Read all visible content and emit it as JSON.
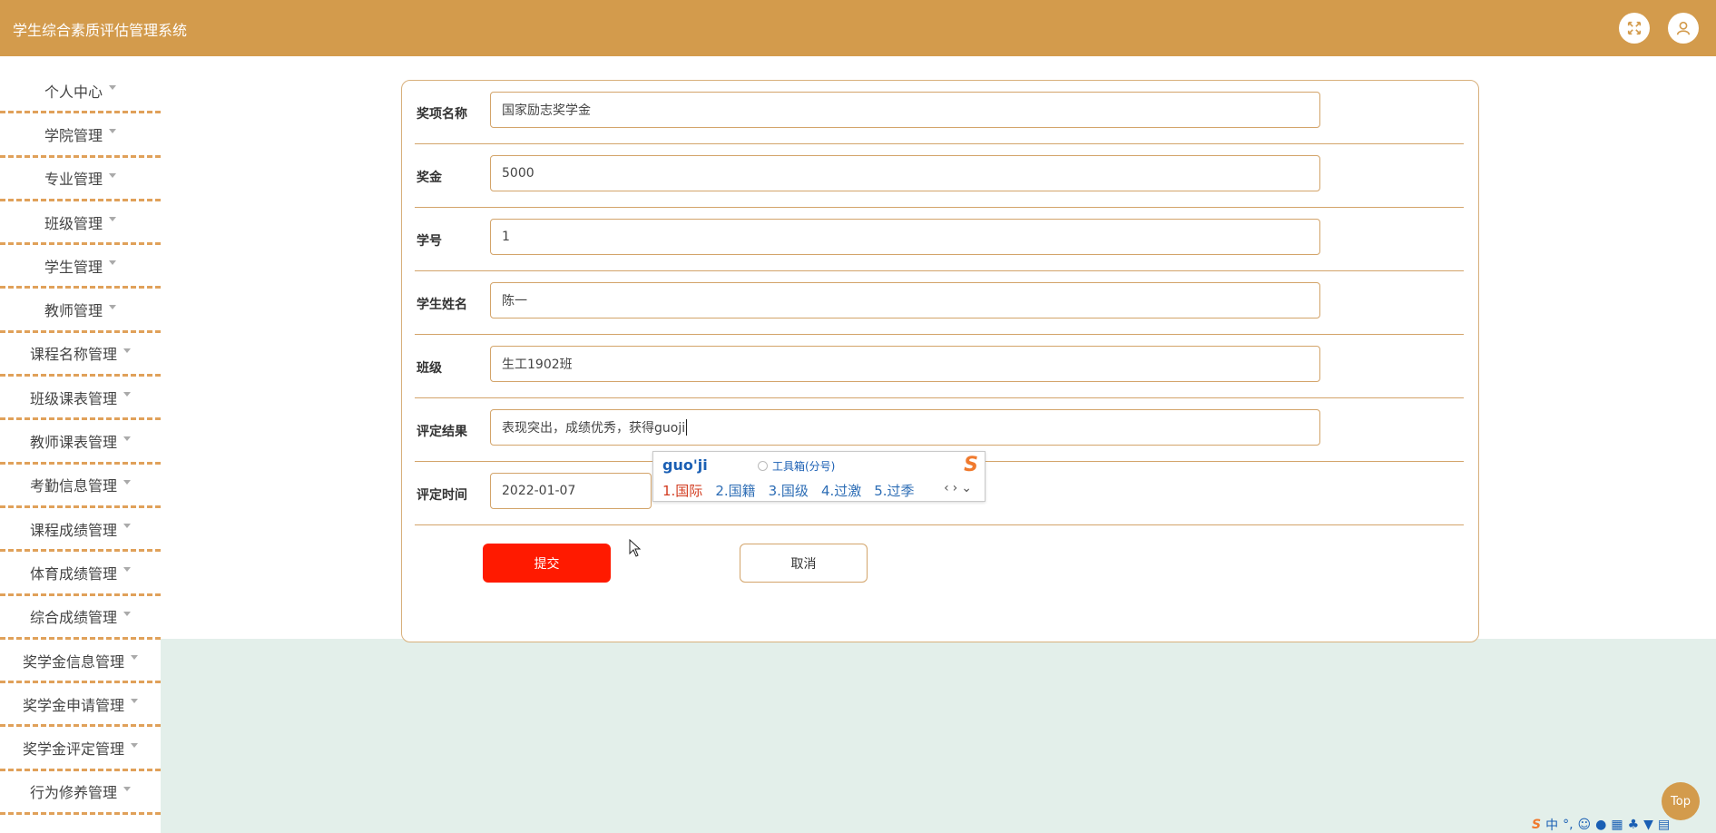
{
  "app": {
    "title": "学生综合素质评估管理系统"
  },
  "header": {
    "fullscreen_icon": "fullscreen-icon",
    "user_icon": "user-icon"
  },
  "sidebar": {
    "items": [
      {
        "label": "个人中心"
      },
      {
        "label": "学院管理"
      },
      {
        "label": "专业管理"
      },
      {
        "label": "班级管理"
      },
      {
        "label": "学生管理"
      },
      {
        "label": "教师管理"
      },
      {
        "label": "课程名称管理"
      },
      {
        "label": "班级课表管理"
      },
      {
        "label": "教师课表管理"
      },
      {
        "label": "考勤信息管理"
      },
      {
        "label": "课程成绩管理"
      },
      {
        "label": "体育成绩管理"
      },
      {
        "label": "综合成绩管理"
      },
      {
        "label": "奖学金信息管理"
      },
      {
        "label": "奖学金申请管理"
      },
      {
        "label": "奖学金评定管理"
      },
      {
        "label": "行为修养管理"
      }
    ]
  },
  "form": {
    "fields": [
      {
        "label": "奖项名称",
        "value": "国家励志奖学金"
      },
      {
        "label": "奖金",
        "value": "5000"
      },
      {
        "label": "学号",
        "value": "1"
      },
      {
        "label": "学生姓名",
        "value": "陈一"
      },
      {
        "label": "班级",
        "value": "生工1902班"
      },
      {
        "label": "评定结果",
        "value": "表现突出，成绩优秀，获得guoji"
      },
      {
        "label": "评定时间",
        "value": "2022-01-07"
      }
    ],
    "submit_label": "提交",
    "cancel_label": "取消"
  },
  "ime": {
    "pinyin": "guo'ji",
    "toolbox": "工具箱(分号)",
    "candidates": [
      "1.国际",
      "2.国籍",
      "3.国级",
      "4.过激",
      "5.过季"
    ]
  },
  "top_button": {
    "label": "Top"
  },
  "tray": {
    "lang": "中"
  },
  "colors": {
    "header": "#d39b4c",
    "submit": "#ff1a00",
    "divider": "#e0a15a",
    "lower_bg": "#e3efea"
  }
}
